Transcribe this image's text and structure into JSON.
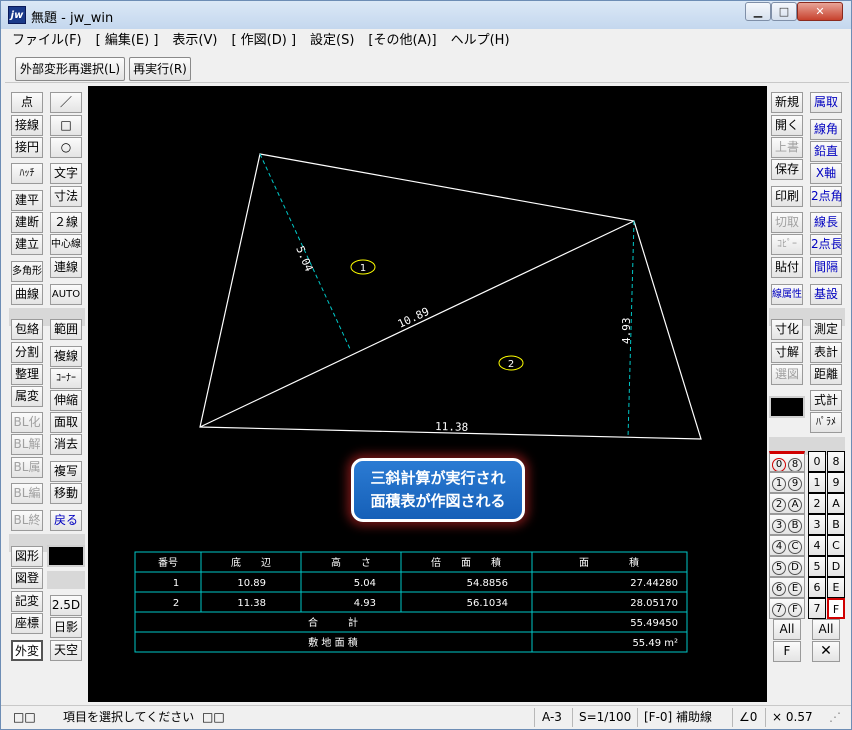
{
  "window": {
    "app_icon": "jw",
    "title": "無題 - jw_win",
    "controls": {
      "minimize_icon": "minimize-icon",
      "maximize_icon": "maximize-icon",
      "close_icon": "close-icon"
    }
  },
  "menu": [
    "ファイル(F)",
    "[ 編集(E) ]",
    "表示(V)",
    "[ 作図(D) ]",
    "設定(S)",
    "[その他(A)]",
    "ヘルプ(H)"
  ],
  "toolbar": {
    "reselect": "外部変形再選択(L)",
    "rerun": "再実行(R)"
  },
  "left_tools": {
    "col1_a": [
      "点",
      "接線",
      "接円",
      "ﾊｯﾁ",
      "建平",
      "建断",
      "建立",
      "多角形",
      "曲線"
    ],
    "col2_a": [
      "／",
      "□",
      "○",
      "文字",
      "寸法",
      "２線",
      "中心線",
      "連線",
      "AUTO"
    ],
    "col1_b": [
      "包絡",
      "分割",
      "整理",
      "属変",
      "BL化",
      "BL解",
      "BL属",
      "BL編",
      "BL終"
    ],
    "col2_b": [
      "範囲",
      "複線",
      "ｺｰﾅｰ",
      "伸縮",
      "面取",
      "消去",
      "複写",
      "移動",
      "戻る"
    ],
    "col1_c": [
      "図形",
      "図登",
      "記変",
      "座標",
      "外変"
    ],
    "col2_c": [
      "2.5D",
      "日影",
      "天空"
    ]
  },
  "right_tools": {
    "col1_a": [
      "新規",
      "開く",
      "上書",
      "保存",
      "印刷",
      "切取",
      "ｺﾋﾟｰ",
      "貼付",
      "線属性"
    ],
    "col2_a": [
      "属取",
      "線角",
      "鉛直",
      "X軸",
      "2点角",
      "線長",
      "2点長",
      "間隔",
      "基設"
    ],
    "col1_b": [
      "寸化",
      "寸解",
      "選図"
    ],
    "col2_b": [
      "測定",
      "表計",
      "距離",
      "式計",
      "ﾊﾟﾗﾒ"
    ],
    "layer_groups_circle": [
      "0",
      "1",
      "2",
      "3",
      "4",
      "5",
      "6",
      "7"
    ],
    "layer_groups_hex": [
      "8",
      "9",
      "A",
      "B",
      "C",
      "D",
      "E",
      "F"
    ],
    "layers_box": [
      "0",
      "1",
      "2",
      "3",
      "4",
      "5",
      "6",
      "7"
    ],
    "layers_box_hex": [
      "8",
      "9",
      "A",
      "B",
      "C",
      "D",
      "E",
      "F"
    ],
    "all_label": "All",
    "f_label": "F",
    "x_icon": "close-x-icon"
  },
  "drawing": {
    "dims": {
      "d1": "5.04",
      "d2": "10.89",
      "d3": "4.93",
      "d4": "11.38"
    },
    "labels": {
      "l1": "1",
      "l2": "2"
    },
    "colors": {
      "outline": "#ffffff",
      "height_line": "#00c8c8",
      "label": "#ffff00",
      "table": "#00c8c8"
    }
  },
  "area_table": {
    "headers": [
      "番号",
      "底　　辺",
      "高　　さ",
      "倍　　面　　積",
      "面　　　　積"
    ],
    "rows": [
      [
        "1",
        "10.89",
        "5.04",
        "54.8856",
        "27.44280"
      ],
      [
        "2",
        "11.38",
        "4.93",
        "56.1034",
        "28.05170"
      ]
    ],
    "total_label": "合　　　計",
    "total_value": "55.49450",
    "site_label": "敷 地 面 積",
    "site_value": "55.49 m²"
  },
  "callout": {
    "line1": "三斜計算が実行され",
    "line2": "面積表が作図される"
  },
  "status": {
    "left_icons": "□□",
    "message": "項目を選択してください",
    "mid_icons": "□□",
    "paper": "A-3",
    "scale": "S=1/100",
    "layer": "[F-0] 補助線",
    "angle": "∠0",
    "zoom": "× 0.57"
  }
}
